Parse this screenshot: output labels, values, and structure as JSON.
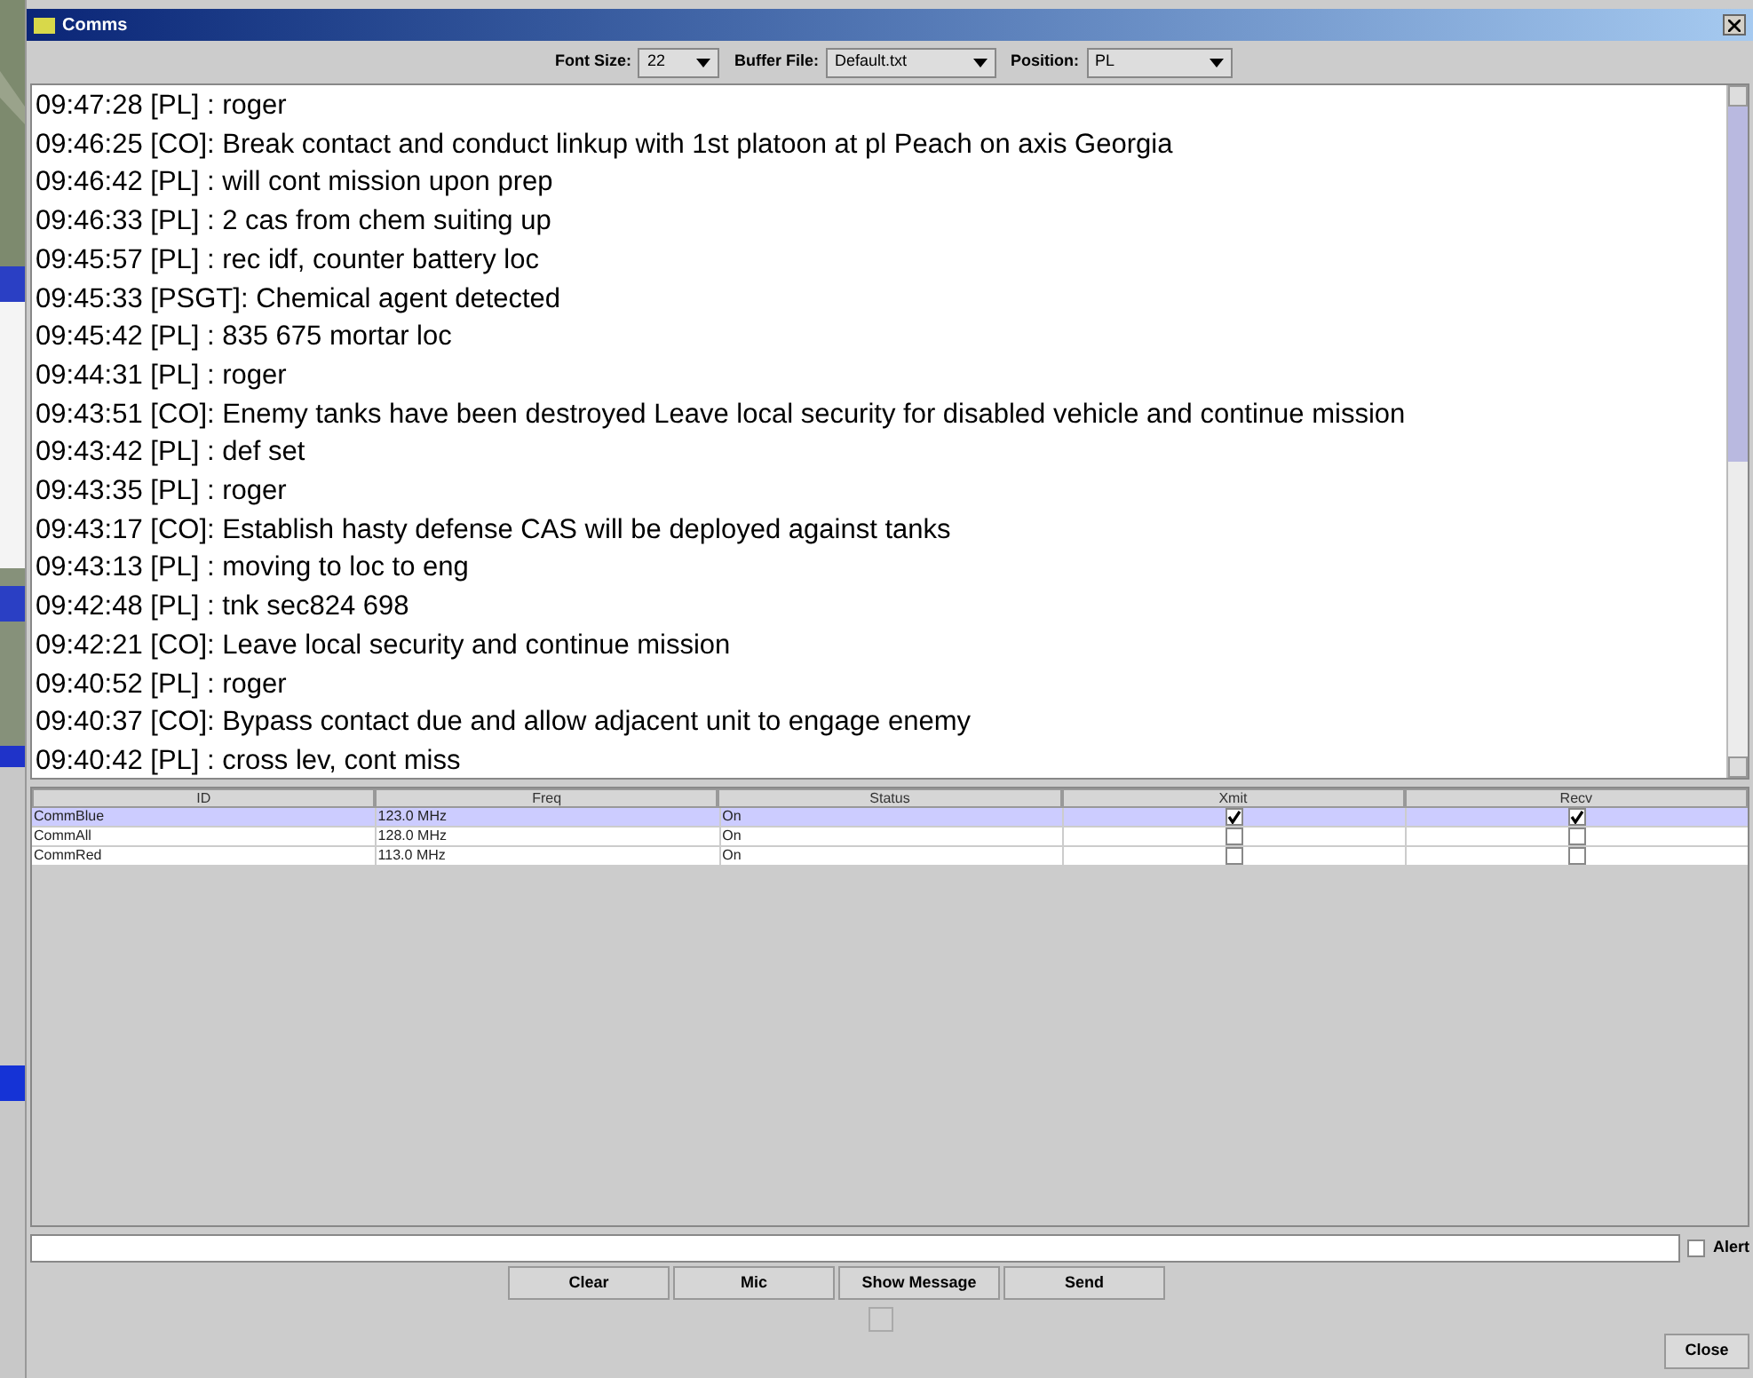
{
  "window": {
    "title": "Comms"
  },
  "toolbar": [
    {
      "label": "Font Size:",
      "value": "22"
    },
    {
      "label": "Buffer File:",
      "value": "Default.txt"
    },
    {
      "label": "Position:",
      "value": "PL"
    }
  ],
  "log": [
    "09:47:28 [PL] : roger",
    "09:46:25 [CO]:  Break contact and conduct linkup with 1st platoon at pl Peach on axis Georgia",
    "09:46:42 [PL] : will cont mission upon prep",
    "09:46:33 [PL] : 2 cas from chem suiting up",
    "09:45:57 [PL] : rec idf, counter battery loc",
    "09:45:33 [PSGT]: Chemical agent detected",
    "09:45:42 [PL] : 835 675 mortar loc",
    "09:44:31 [PL] : roger",
    "09:43:51 [CO]: Enemy tanks have been destroyed Leave local security for disabled vehicle and continue mission",
    "09:43:42 [PL] : def set",
    "09:43:35 [PL] : roger",
    "09:43:17 [CO]: Establish hasty defense CAS will be deployed against tanks",
    "09:43:13 [PL] : moving to loc to eng",
    "09:42:48 [PL] : tnk sec824 698",
    "09:42:21 [CO]: Leave local security and continue mission",
    "09:40:52 [PL] : roger",
    "09:40:37 [CO]: Bypass contact due and allow adjacent unit to engage enemy",
    "09:40:42 [PL] : cross lev, cont miss"
  ],
  "table": {
    "columns": [
      "ID",
      "Freq",
      "Status",
      "Xmit",
      "Recv"
    ],
    "rows": [
      {
        "id": "CommBlue",
        "freq": "123.0 MHz",
        "status": "On",
        "xmit": true,
        "recv": true,
        "selected": true
      },
      {
        "id": "CommAll",
        "freq": "128.0 MHz",
        "status": "On",
        "xmit": false,
        "recv": false,
        "selected": false
      },
      {
        "id": "CommRed",
        "freq": "113.0 MHz",
        "status": "On",
        "xmit": false,
        "recv": false,
        "selected": false
      }
    ]
  },
  "message": {
    "alert_label": "Alert",
    "alert_checked": false
  },
  "buttons": [
    "Clear",
    "Mic",
    "Show Message",
    "Send"
  ],
  "mic_indicator": {
    "checked": false
  },
  "close_button": "Close"
}
